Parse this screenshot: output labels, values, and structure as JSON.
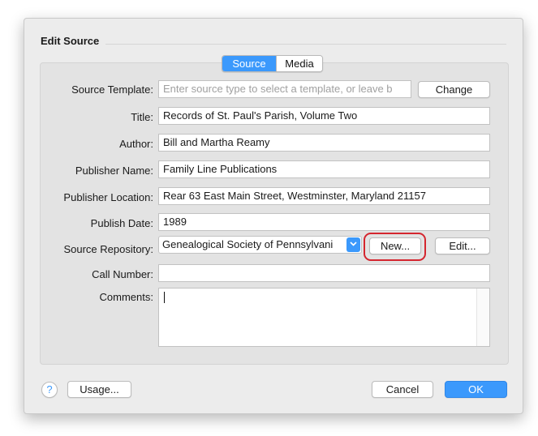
{
  "dialog": {
    "title": "Edit Source"
  },
  "tabs": [
    {
      "label": "Source",
      "active": true
    },
    {
      "label": "Media",
      "active": false
    }
  ],
  "fields": {
    "source_template": {
      "label": "Source Template:",
      "placeholder": "Enter source type to select a template, or leave b",
      "button": "Change"
    },
    "title": {
      "label": "Title:",
      "value": "Records of St. Paul's Parish, Volume Two"
    },
    "author": {
      "label": "Author:",
      "value": "Bill and Martha Reamy"
    },
    "publisher_name": {
      "label": "Publisher Name:",
      "value": "Family Line Publications"
    },
    "publisher_location": {
      "label": "Publisher Location:",
      "value": "Rear 63 East Main Street, Westminster, Maryland 21157"
    },
    "publish_date": {
      "label": "Publish Date:",
      "value": "1989"
    },
    "source_repository": {
      "label": "Source Repository:",
      "value": "Genealogical Society of Pennsylvani",
      "new_button": "New...",
      "edit_button": "Edit..."
    },
    "call_number": {
      "label": "Call Number:",
      "value": ""
    },
    "comments": {
      "label": "Comments:",
      "value": ""
    }
  },
  "footer": {
    "help": "?",
    "usage": "Usage...",
    "cancel": "Cancel",
    "ok": "OK"
  },
  "colors": {
    "accent": "#3b99fc",
    "highlight": "#d4262f"
  },
  "icons": {
    "popup_arrow": "chevron-down-icon",
    "help": "help-icon"
  }
}
